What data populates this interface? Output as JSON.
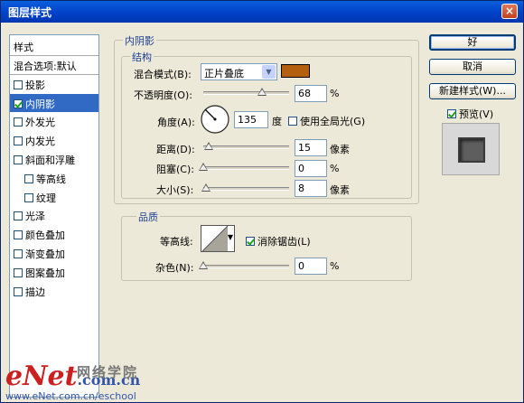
{
  "window": {
    "title": "图层样式",
    "close_glyph": "×"
  },
  "style_list": {
    "header": "样式",
    "blend_options": "混合选项:默认",
    "items": [
      {
        "label": "投影",
        "checked": false,
        "indent": false,
        "selected": false
      },
      {
        "label": "内阴影",
        "checked": true,
        "indent": false,
        "selected": true
      },
      {
        "label": "外发光",
        "checked": false,
        "indent": false,
        "selected": false
      },
      {
        "label": "内发光",
        "checked": false,
        "indent": false,
        "selected": false
      },
      {
        "label": "斜面和浮雕",
        "checked": false,
        "indent": false,
        "selected": false
      },
      {
        "label": "等高线",
        "checked": false,
        "indent": true,
        "selected": false
      },
      {
        "label": "纹理",
        "checked": false,
        "indent": true,
        "selected": false
      },
      {
        "label": "光泽",
        "checked": false,
        "indent": false,
        "selected": false
      },
      {
        "label": "颜色叠加",
        "checked": false,
        "indent": false,
        "selected": false
      },
      {
        "label": "渐变叠加",
        "checked": false,
        "indent": false,
        "selected": false
      },
      {
        "label": "图案叠加",
        "checked": false,
        "indent": false,
        "selected": false
      },
      {
        "label": "描边",
        "checked": false,
        "indent": false,
        "selected": false
      }
    ]
  },
  "inner_shadow": {
    "group_title": "内阴影",
    "structure_title": "结构",
    "blend_mode_label": "混合模式(B):",
    "blend_mode_value": "正片叠底",
    "shadow_color": "#b45f0e",
    "opacity_label": "不透明度(O):",
    "opacity_value": "68",
    "opacity_unit": "%",
    "opacity_fraction": 0.68,
    "angle_label": "角度(A):",
    "angle_value": "135",
    "angle_unit": "度",
    "global_light_label": "使用全局光(G)",
    "global_light_checked": false,
    "distance_label": "距离(D):",
    "distance_value": "15",
    "distance_unit": "像素",
    "distance_fraction": 0.06,
    "choke_label": "阻塞(C):",
    "choke_value": "0",
    "choke_unit": "%",
    "choke_fraction": 0,
    "size_label": "大小(S):",
    "size_value": "8",
    "size_unit": "像素",
    "size_fraction": 0.03
  },
  "quality": {
    "group_title": "品质",
    "contour_label": "等高线:",
    "antialias_label": "消除锯齿(L)",
    "antialias_checked": true,
    "noise_label": "杂色(N):",
    "noise_value": "0",
    "noise_unit": "%",
    "noise_fraction": 0
  },
  "buttons": {
    "ok": "好",
    "cancel": "取消",
    "new_style": "新建样式(W)..."
  },
  "preview": {
    "label": "预览(V)",
    "checked": true
  },
  "watermark": {
    "brand": "eNet",
    "brand_suffix": ".com.cn",
    "cn_text": "网络学院",
    "url": "www.eNet.com.cn/eschool"
  }
}
